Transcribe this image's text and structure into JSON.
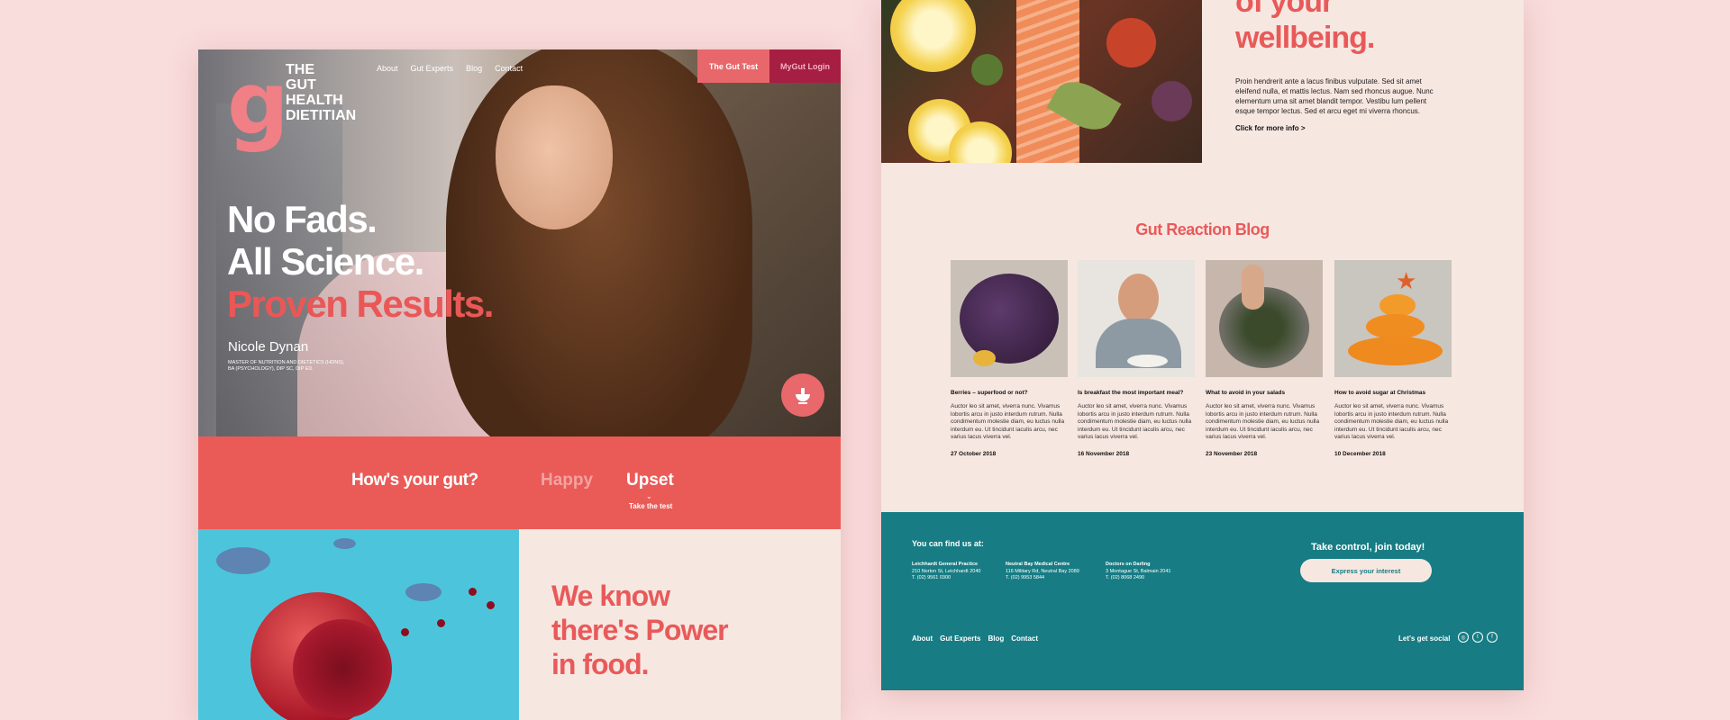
{
  "left": {
    "logo": {
      "mark": "g",
      "lines": [
        "THE",
        "GUT",
        "HEALTH",
        "DIETITIAN"
      ]
    },
    "nav": [
      "About",
      "Gut Experts",
      "Blog",
      "Contact"
    ],
    "cta_test": "The Gut Test",
    "cta_login": "MyGut Login",
    "headline": {
      "line1": "No Fads.",
      "line2": "All Science.",
      "line3": "Proven Results."
    },
    "author": "Nicole Dynan",
    "credentials": "MASTER OF NUTRITION AND DIETETICS (HONS), BA (PSYCHOLOGY), DIP SC, DIP ED.",
    "gut": {
      "question": "How's your gut?",
      "happy": "Happy",
      "upset": "Upset",
      "take": "Take the test"
    },
    "power": "We know there's Power in food."
  },
  "right": {
    "wellbeing": {
      "line1": "of your",
      "line2": "wellbeing."
    },
    "intro": "Proin hendrerit ante a lacus finibus vulputate. Sed sit amet eleifend nulla, et mattis lectus. Nam sed rhoncus augue. Nunc elementum urna sit amet blandit tempor. Vestibu lum pellent esque tempor lectus. Sed et arcu eget mi viverra rhoncus.",
    "more": "Click for more info  >",
    "blog_title": "Gut Reaction Blog",
    "posts": [
      {
        "title": "Berries – superfood or not?",
        "text": "Auctor leo sit amet, viverra nunc. Vivamus lobortis arcu in justo interdum rutrum. Nulla condimentum molestie diam, eu luctus nulla interdum eu. Ut tincidunt iaculis arcu, nec varius lacus viverra vel.",
        "date": "27 October 2018"
      },
      {
        "title": "Is breakfast the most important meal?",
        "text": "Auctor leo sit amet, viverra nunc. Vivamus lobortis arcu in justo interdum rutrum. Nulla condimentum molestie diam, eu luctus nulla interdum eu. Ut tincidunt iaculis arcu, nec varius lacus viverra vel.",
        "date": "16 November 2018"
      },
      {
        "title": "What to avoid in your salads",
        "text": "Auctor leo sit amet, viverra nunc. Vivamus lobortis arcu in justo interdum rutrum. Nulla condimentum molestie diam, eu luctus nulla interdum eu. Ut tincidunt iaculis arcu, nec varius lacus viverra vel.",
        "date": "23 November 2018"
      },
      {
        "title": "How to avoid sugar at Christmas",
        "text": "Auctor leo sit amet, viverra nunc. Vivamus lobortis arcu in justo interdum rutrum. Nulla condimentum molestie diam, eu luctus nulla interdum eu. Ut tincidunt iaculis arcu, nec varius lacus viverra vel.",
        "date": "10 December 2018"
      }
    ],
    "footer": {
      "find": "You can find us at:",
      "locations": [
        {
          "name": "Leichhardt General Practice",
          "addr": "210 Norton St, Leichhardt 2040",
          "phone": "T. (02) 9561 0300"
        },
        {
          "name": "Neutral Bay Medical Centre",
          "addr": "116 Military Rd, Neutral Bay 2089",
          "phone": "T. (02) 9953 5844"
        },
        {
          "name": "Doctors on Darling",
          "addr": "3 Montague St, Balmain 2041",
          "phone": "T. (02) 8068 2490"
        }
      ],
      "join": "Take control, join today!",
      "express": "Express your interest",
      "nav": [
        "About",
        "Gut Experts",
        "Blog",
        "Contact"
      ],
      "social": "Let's get social",
      "social_icons": [
        "instagram-icon",
        "twitter-icon",
        "facebook-icon"
      ]
    }
  },
  "colors": {
    "accent": "#ea5b57",
    "teal": "#177c84",
    "cream": "#f7e7e1",
    "background": "#f9dcdc",
    "login": "#a71e43"
  }
}
